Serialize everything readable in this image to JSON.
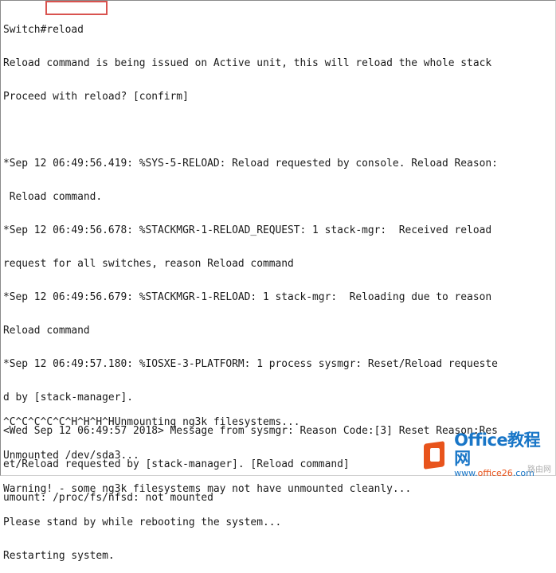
{
  "terminal": {
    "prompt": "Switch#",
    "command": "reload",
    "lines": [
      "Reload command is being issued on Active unit, this will reload the whole stack",
      "Proceed with reload? [confirm]",
      "",
      "*Sep 12 06:49:56.419: %SYS-5-RELOAD: Reload requested by console. Reload Reason:",
      " Reload command.",
      "*Sep 12 06:49:56.678: %STACKMGR-1-RELOAD_REQUEST: 1 stack-mgr:  Received reload",
      "request for all switches, reason Reload command",
      "*Sep 12 06:49:56.679: %STACKMGR-1-RELOAD: 1 stack-mgr:  Reloading due to reason",
      "Reload command",
      "*Sep 12 06:49:57.180: %IOSXE-3-PLATFORM: 1 process sysmgr: Reset/Reload requeste",
      "d by [stack-manager].",
      "<Wed Sep 12 06:49:57 2018> Message from sysmgr: Reason Code:[3] Reset Reason:Res",
      "et/Reload requested by [stack-manager]. [Reload command]",
      "umount: /proc/fs/nfsd: not mounted"
    ],
    "bottom_lines": [
      "^C^C^C^C^C^H^H^H^HUnmounting ng3k filesystems...",
      "Unmounted /dev/sda3...",
      "Warning! - some ng3k filesystems may not have unmounted cleanly...",
      "Please stand by while rebooting the system...",
      "Restarting system."
    ]
  },
  "watermark": {
    "brand": "Office",
    "brand_cn": "教程网",
    "url_prefix": "www.",
    "url_mid": "office26",
    "url_suffix": ".com",
    "corner": "路由网"
  },
  "colors": {
    "highlight_box": "#d9534f",
    "watermark_blue": "#1976c7",
    "watermark_orange": "#e8541c"
  }
}
